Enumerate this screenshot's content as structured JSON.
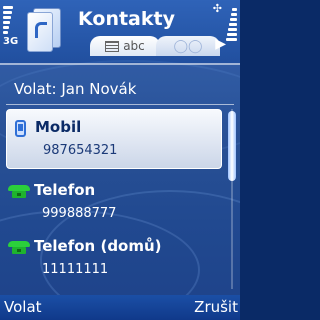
{
  "header": {
    "title": "Kontakty",
    "network": "3G",
    "signal_level": 0.7,
    "battery_level": 0.8,
    "icons": {
      "app": "contacts-book-icon",
      "signal": "signal-strength-icon",
      "battery": "battery-icon",
      "charging": "charging-indicator-icon"
    }
  },
  "tabs": [
    {
      "label": "abc",
      "icon": "contact-list-icon",
      "active": true
    },
    {
      "label": "",
      "icon": "groups-icon",
      "active": false
    }
  ],
  "main": {
    "heading": "Volat: Jan Novák",
    "items": [
      {
        "label": "Mobil",
        "value": "987654321",
        "icon": "mobile-phone-icon",
        "selected": true
      },
      {
        "label": "Telefon",
        "value": "999888777",
        "icon": "landline-phone-icon",
        "selected": false
      },
      {
        "label": "Telefon (domů)",
        "value": "11111111",
        "icon": "landline-phone-icon",
        "selected": false
      }
    ]
  },
  "softkeys": {
    "left": "Volat",
    "right": "Zrušit"
  },
  "colors": {
    "background": "#16418c",
    "selection": "#dfe6f2",
    "phone_green": "#2bd03b",
    "mobile_blue": "#2f6fd6"
  }
}
